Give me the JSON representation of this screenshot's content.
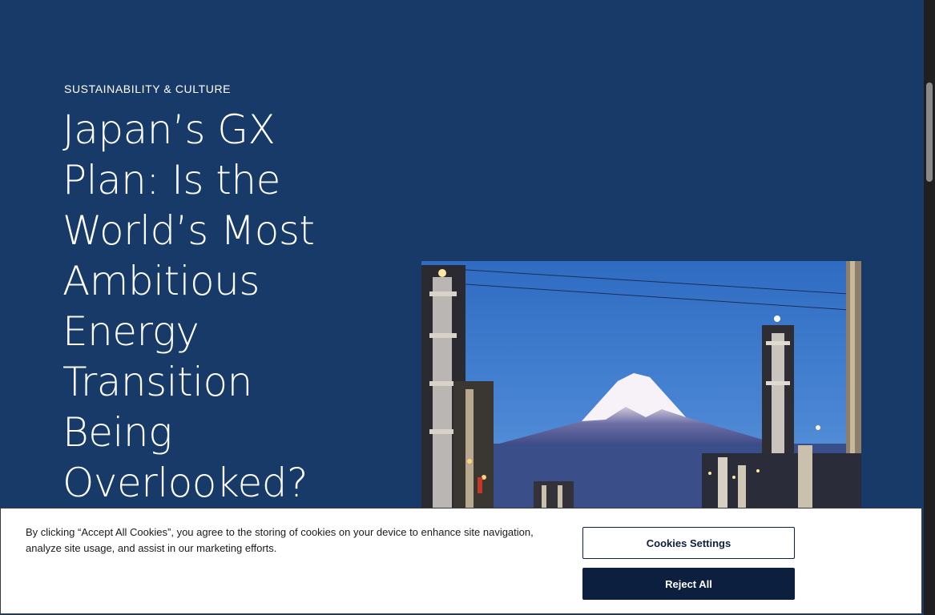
{
  "article": {
    "category": "SUSTAINABILITY & CULTURE",
    "title_lines": [
      "Japan’s GX",
      "Plan: Is the",
      "World’s Most",
      "Ambitious",
      "Energy",
      "Transition",
      "Being",
      "Overlooked?"
    ]
  },
  "cookie_banner": {
    "text": "By clicking “Accept All Cookies”, you agree to the storing of cookies on your device to enhance site navigation, analyze site usage, and assist in our marketing efforts.",
    "settings_label": "Cookies Settings",
    "reject_label": "Reject All"
  },
  "colors": {
    "background": "#173a68",
    "banner_button_dark": "#0c1f3f"
  }
}
